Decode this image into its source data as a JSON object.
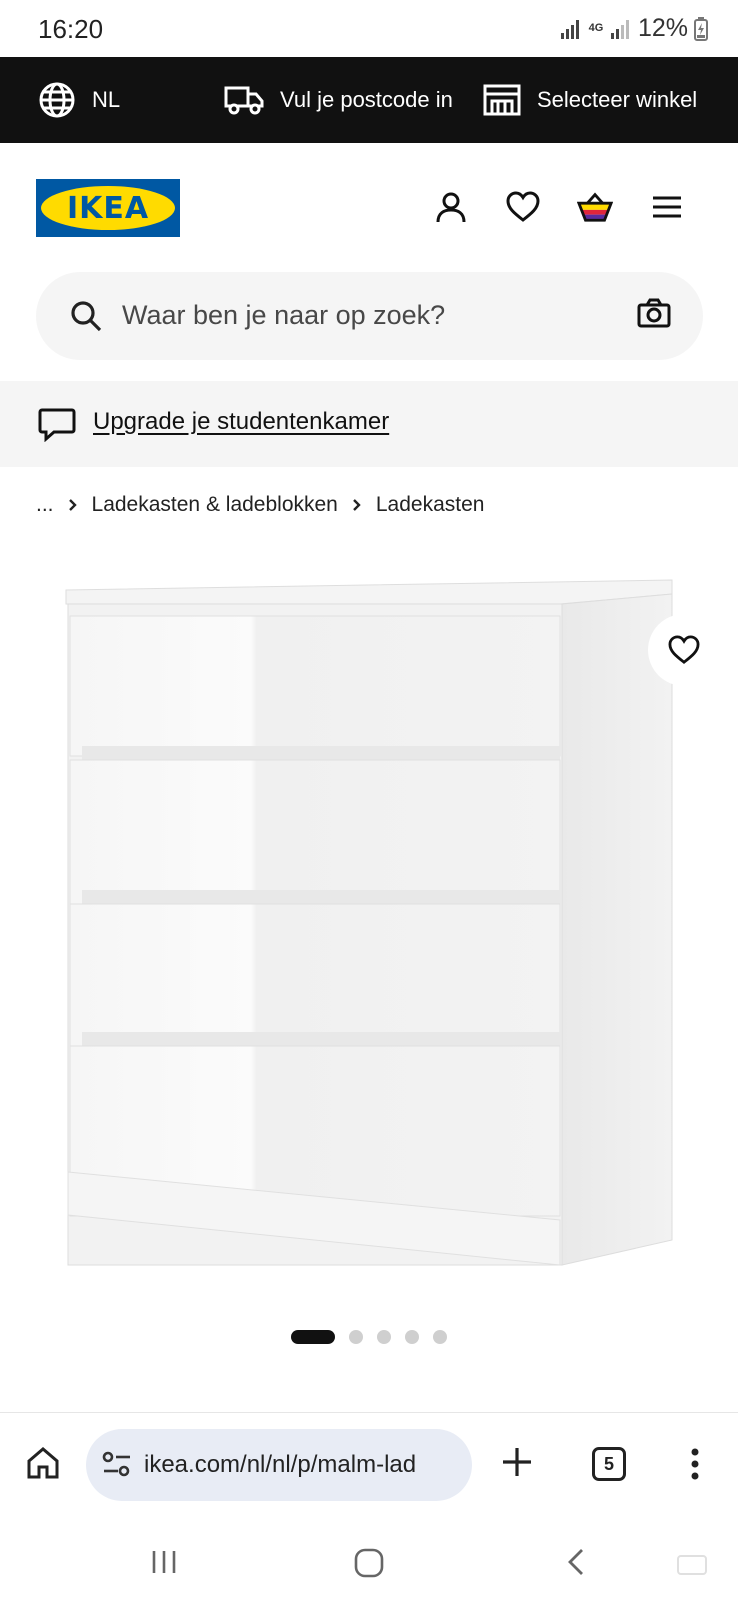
{
  "status_bar": {
    "time": "16:20",
    "network_type": "4G",
    "battery": "12%"
  },
  "topbar": {
    "language": "NL",
    "postcode_label": "Vul je postcode in",
    "store_label": "Selecteer winkel"
  },
  "header": {
    "logo_text": "IKEA",
    "brand_colors": {
      "blue": "#0058a3",
      "yellow": "#ffdb00"
    },
    "icons": [
      "user-icon",
      "heart-icon",
      "basket-icon",
      "menu-icon"
    ]
  },
  "search": {
    "placeholder": "Waar ben je naar op zoek?"
  },
  "promo": {
    "link_text": "Upgrade je studentenkamer"
  },
  "breadcrumb": {
    "items": [
      "...",
      "Ladekasten & ladeblokken",
      "Ladekasten"
    ]
  },
  "carousel": {
    "total_images": 5,
    "active_index": 0
  },
  "browser": {
    "url": "ikea.com/nl/nl/p/malm-lad",
    "tab_count": "5"
  }
}
